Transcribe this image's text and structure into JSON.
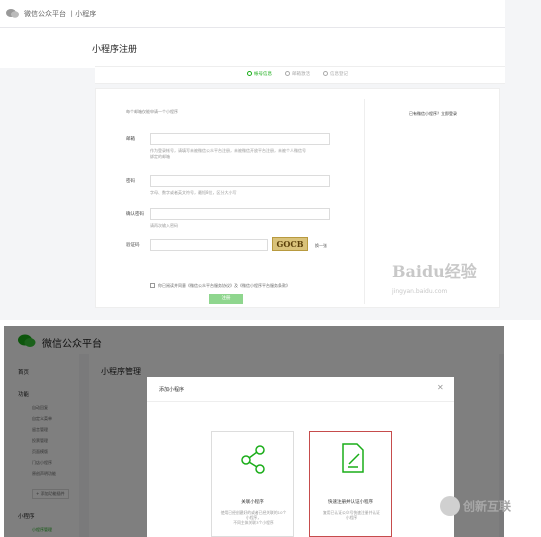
{
  "register": {
    "header": {
      "logo_icon": "wechat-logo-icon",
      "title": "微信公众平台 丨小程序"
    },
    "page_title": "小程序注册",
    "steps": [
      {
        "label": "帐号信息"
      },
      {
        "label": "邮箱激活"
      },
      {
        "label": "信息登记"
      }
    ],
    "intro": "每个邮箱仅能申请一个小程序",
    "form": {
      "email_label": "邮箱",
      "email_hint_1": "作为登录帐号，请填写未被微信公众平台注册，未被微信开放平台注册，未被个人微信号",
      "email_hint_2": "绑定的邮箱",
      "password_label": "密码",
      "password_hint": "字母、数字或者英文符号，最短8位，区分大小写",
      "confirm_label": "确认密码",
      "confirm_hint": "请再次输入密码",
      "captcha_label": "验证码",
      "captcha_text": "GOCB",
      "captcha_refresh": "换一张",
      "agree_text": "你已阅读并同意《微信公众平台服务协议》及《微信小程序平台服务条款》",
      "submit_label": "注册"
    },
    "login_hint": "已有微信小程序？立即登录",
    "watermark": {
      "logo": "Baidu经验",
      "url": "jingyan.baidu.com"
    }
  },
  "admin": {
    "header": {
      "logo_icon": "wechat-logo-icon",
      "title": "微信公众平台"
    },
    "sidebar": {
      "home": "首页",
      "func_title": "功能",
      "items": [
        "自动回复",
        "自定义菜单",
        "留言管理",
        "投票管理",
        "页面模版",
        "门店小程序",
        "原创声明功能"
      ],
      "add_plugin": "+ 添加功能插件",
      "mini_title": "小程序",
      "mini_items": [
        "小程序管理"
      ]
    },
    "main_title": "小程序管理",
    "dialog": {
      "title": "添加小程序",
      "close_icon": "close-icon",
      "options": [
        {
          "label": "关联小程序",
          "desc_1": "使用已经创建好的或者已经关联的10个小程序，",
          "desc_2": "不同主体关联3个小程序",
          "icon": "share-nodes-icon"
        },
        {
          "label": "快速注册并认证小程序",
          "desc_1": "复用已认证公众号快速注册并认证",
          "desc_2": "小程序",
          "icon": "document-edit-icon"
        }
      ]
    }
  },
  "watermark2": {
    "text": "创新互联"
  },
  "colors": {
    "brand_green": "#1aad19",
    "highlight_red": "#c64c4c"
  }
}
